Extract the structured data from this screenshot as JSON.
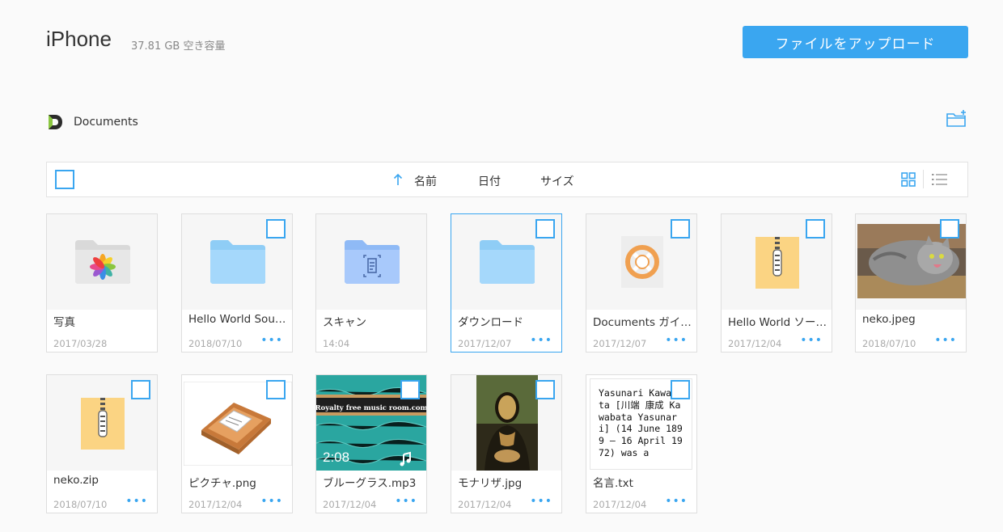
{
  "header": {
    "device": "iPhone",
    "storage": "37.81 GB 空き容量",
    "upload_label": "ファイルをアップロード"
  },
  "breadcrumb": {
    "label": "Documents"
  },
  "toolbar": {
    "sort_name": "名前",
    "sort_date": "日付",
    "sort_size": "サイズ"
  },
  "colors": {
    "accent": "#3aa6f0",
    "folder": "#a5d8fb"
  },
  "files": [
    {
      "name": "写真",
      "date": "2017/03/28",
      "type": "photos-folder",
      "more": ""
    },
    {
      "name": "Hello World Sour…",
      "date": "2018/07/10",
      "type": "folder",
      "more": "•••"
    },
    {
      "name": "スキャン",
      "date": "14:04",
      "type": "scan-folder",
      "more": ""
    },
    {
      "name": "ダウンロード",
      "date": "2017/12/07",
      "type": "folder",
      "more": "•••"
    },
    {
      "name": "Documents ガイ…",
      "date": "2017/12/07",
      "type": "guide",
      "more": "•••"
    },
    {
      "name": "Hello World ソー…",
      "date": "2017/12/04",
      "type": "zip",
      "more": "•••"
    },
    {
      "name": "neko.jpeg",
      "date": "2018/07/10",
      "type": "image",
      "more": "•••"
    },
    {
      "name": "neko.zip",
      "date": "2018/07/10",
      "type": "zip",
      "more": "•••"
    },
    {
      "name": "ピクチャ.png",
      "date": "2017/12/04",
      "type": "image",
      "more": "•••"
    },
    {
      "name": "ブルーグラス.mp3",
      "date": "2017/12/04",
      "type": "audio",
      "more": "•••",
      "overlay_time": "2:08",
      "banner_line1": "Royalty free music room.com"
    },
    {
      "name": "モナリザ.jpg",
      "date": "2017/12/04",
      "type": "image",
      "more": "•••"
    },
    {
      "name": "名言.txt",
      "date": "2017/12/04",
      "type": "text",
      "more": "•••",
      "preview": "Yasunari Kawabata [川端 康成 Kawabata Yasunari] (14 June 1899 – 16 April 1972) was a"
    }
  ]
}
